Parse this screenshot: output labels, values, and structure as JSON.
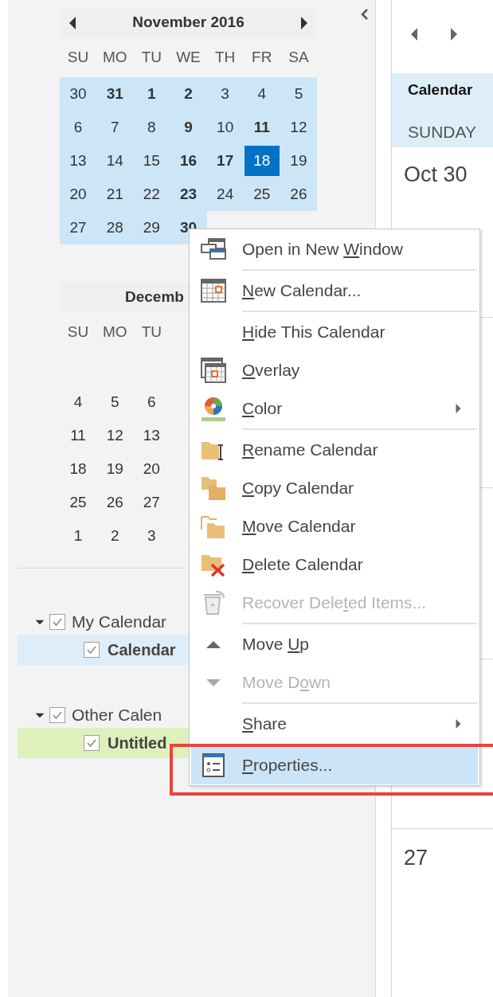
{
  "mini_calendars": [
    {
      "title": "November 2016",
      "nav": true,
      "weekdays": [
        "SU",
        "MO",
        "TU",
        "WE",
        "TH",
        "FR",
        "SA"
      ],
      "weeks": [
        [
          {
            "day": "30",
            "bold": false,
            "selected": false,
            "in_view": true
          },
          {
            "day": "31",
            "bold": true,
            "selected": false,
            "in_view": true
          },
          {
            "day": "1",
            "bold": true,
            "selected": false,
            "in_view": true
          },
          {
            "day": "2",
            "bold": true,
            "selected": false,
            "in_view": true
          },
          {
            "day": "3",
            "bold": false,
            "selected": false,
            "in_view": true
          },
          {
            "day": "4",
            "bold": false,
            "selected": false,
            "in_view": true
          },
          {
            "day": "5",
            "bold": false,
            "selected": false,
            "in_view": true
          }
        ],
        [
          {
            "day": "6",
            "bold": false,
            "selected": false,
            "in_view": true
          },
          {
            "day": "7",
            "bold": false,
            "selected": false,
            "in_view": true
          },
          {
            "day": "8",
            "bold": false,
            "selected": false,
            "in_view": true
          },
          {
            "day": "9",
            "bold": true,
            "selected": false,
            "in_view": true
          },
          {
            "day": "10",
            "bold": false,
            "selected": false,
            "in_view": true
          },
          {
            "day": "11",
            "bold": true,
            "selected": false,
            "in_view": true
          },
          {
            "day": "12",
            "bold": false,
            "selected": false,
            "in_view": true
          }
        ],
        [
          {
            "day": "13",
            "bold": false,
            "selected": false,
            "in_view": true
          },
          {
            "day": "14",
            "bold": false,
            "selected": false,
            "in_view": true
          },
          {
            "day": "15",
            "bold": false,
            "selected": false,
            "in_view": true
          },
          {
            "day": "16",
            "bold": true,
            "selected": false,
            "in_view": true
          },
          {
            "day": "17",
            "bold": true,
            "selected": false,
            "in_view": true
          },
          {
            "day": "18",
            "bold": false,
            "selected": true,
            "in_view": true
          },
          {
            "day": "19",
            "bold": false,
            "selected": false,
            "in_view": true
          }
        ],
        [
          {
            "day": "20",
            "bold": false,
            "selected": false,
            "in_view": true
          },
          {
            "day": "21",
            "bold": false,
            "selected": false,
            "in_view": true
          },
          {
            "day": "22",
            "bold": false,
            "selected": false,
            "in_view": true
          },
          {
            "day": "23",
            "bold": true,
            "selected": false,
            "in_view": true
          },
          {
            "day": "24",
            "bold": false,
            "selected": false,
            "in_view": true
          },
          {
            "day": "25",
            "bold": false,
            "selected": false,
            "in_view": true
          },
          {
            "day": "26",
            "bold": false,
            "selected": false,
            "in_view": true
          }
        ],
        [
          {
            "day": "27",
            "bold": false,
            "selected": false,
            "in_view": true
          },
          {
            "day": "28",
            "bold": false,
            "selected": false,
            "in_view": true
          },
          {
            "day": "29",
            "bold": false,
            "selected": false,
            "in_view": true
          },
          {
            "day": "30",
            "bold": true,
            "selected": false,
            "in_view": true
          }
        ]
      ]
    },
    {
      "title": "Decemb",
      "nav": false,
      "weekdays": [
        "SU",
        "MO",
        "TU"
      ],
      "weeks": [
        [
          {
            "day": "4",
            "bold": false,
            "selected": false,
            "in_view": false
          },
          {
            "day": "5",
            "bold": false,
            "selected": false,
            "in_view": false
          },
          {
            "day": "6",
            "bold": false,
            "selected": false,
            "in_view": false
          }
        ],
        [
          {
            "day": "11",
            "bold": false,
            "selected": false,
            "in_view": false
          },
          {
            "day": "12",
            "bold": false,
            "selected": false,
            "in_view": false
          },
          {
            "day": "13",
            "bold": false,
            "selected": false,
            "in_view": false
          }
        ],
        [
          {
            "day": "18",
            "bold": false,
            "selected": false,
            "in_view": false
          },
          {
            "day": "19",
            "bold": false,
            "selected": false,
            "in_view": false
          },
          {
            "day": "20",
            "bold": false,
            "selected": false,
            "in_view": false
          }
        ],
        [
          {
            "day": "25",
            "bold": false,
            "selected": false,
            "in_view": false
          },
          {
            "day": "26",
            "bold": false,
            "selected": false,
            "in_view": false
          },
          {
            "day": "27",
            "bold": false,
            "selected": false,
            "in_view": false
          }
        ],
        [
          {
            "day": "1",
            "bold": false,
            "selected": false,
            "in_view": false
          },
          {
            "day": "2",
            "bold": false,
            "selected": false,
            "in_view": false
          },
          {
            "day": "3",
            "bold": false,
            "selected": false,
            "in_view": false
          }
        ]
      ]
    }
  ],
  "calendar_groups": [
    {
      "label": "My Calendar",
      "expanded": true,
      "checked": true,
      "children": [
        {
          "label": "Calendar",
          "checked": true,
          "color": "#ddedf9"
        }
      ]
    },
    {
      "label": "Other Calen",
      "expanded": true,
      "checked": true,
      "children": [
        {
          "label": "Untitled",
          "checked": true,
          "color": "#dff0bd"
        }
      ]
    }
  ],
  "view": {
    "header_title": "Calendar",
    "weekday": "SUNDAY",
    "cells": [
      "Oct 30",
      "27"
    ]
  },
  "context_menu": {
    "items": [
      {
        "pre": "Open in New ",
        "key": "W",
        "post": "indow",
        "disabled": false,
        "submenu": false,
        "selected": false,
        "separator_after": true
      },
      {
        "key": "N",
        "post": "ew Calendar...",
        "disabled": false,
        "submenu": false,
        "selected": false,
        "separator_after": true
      },
      {
        "key": "H",
        "post": "ide This Calendar",
        "disabled": false,
        "submenu": false,
        "selected": false,
        "separator_after": false
      },
      {
        "key": "O",
        "post": "verlay",
        "disabled": false,
        "submenu": false,
        "selected": false,
        "separator_after": false
      },
      {
        "key": "C",
        "post": "olor",
        "disabled": false,
        "submenu": true,
        "selected": false,
        "separator_after": true
      },
      {
        "key": "R",
        "post": "ename Calendar",
        "disabled": false,
        "submenu": false,
        "selected": false,
        "separator_after": false
      },
      {
        "key": "C",
        "post": "opy Calendar",
        "disabled": false,
        "submenu": false,
        "selected": false,
        "separator_after": false
      },
      {
        "key": "M",
        "post": "ove Calendar",
        "disabled": false,
        "submenu": false,
        "selected": false,
        "separator_after": false
      },
      {
        "key": "D",
        "post": "elete Calendar",
        "disabled": false,
        "submenu": false,
        "selected": false,
        "separator_after": false
      },
      {
        "pre": "Recover Dele",
        "key": "t",
        "post": "ed Items...",
        "disabled": true,
        "submenu": false,
        "selected": false,
        "separator_after": true
      },
      {
        "pre": "Move ",
        "key": "U",
        "post": "p",
        "disabled": false,
        "submenu": false,
        "selected": false,
        "separator_after": false
      },
      {
        "pre": "Move D",
        "key": "o",
        "post": "wn",
        "disabled": true,
        "submenu": false,
        "selected": false,
        "separator_after": true
      },
      {
        "key": "S",
        "post": "hare",
        "disabled": false,
        "submenu": true,
        "selected": false,
        "separator_after": true
      },
      {
        "key": "P",
        "post": "roperties...",
        "disabled": false,
        "submenu": false,
        "selected": true,
        "separator_after": false
      }
    ]
  },
  "annotation": {
    "kind": "rectangle",
    "color": "#e8453c"
  }
}
